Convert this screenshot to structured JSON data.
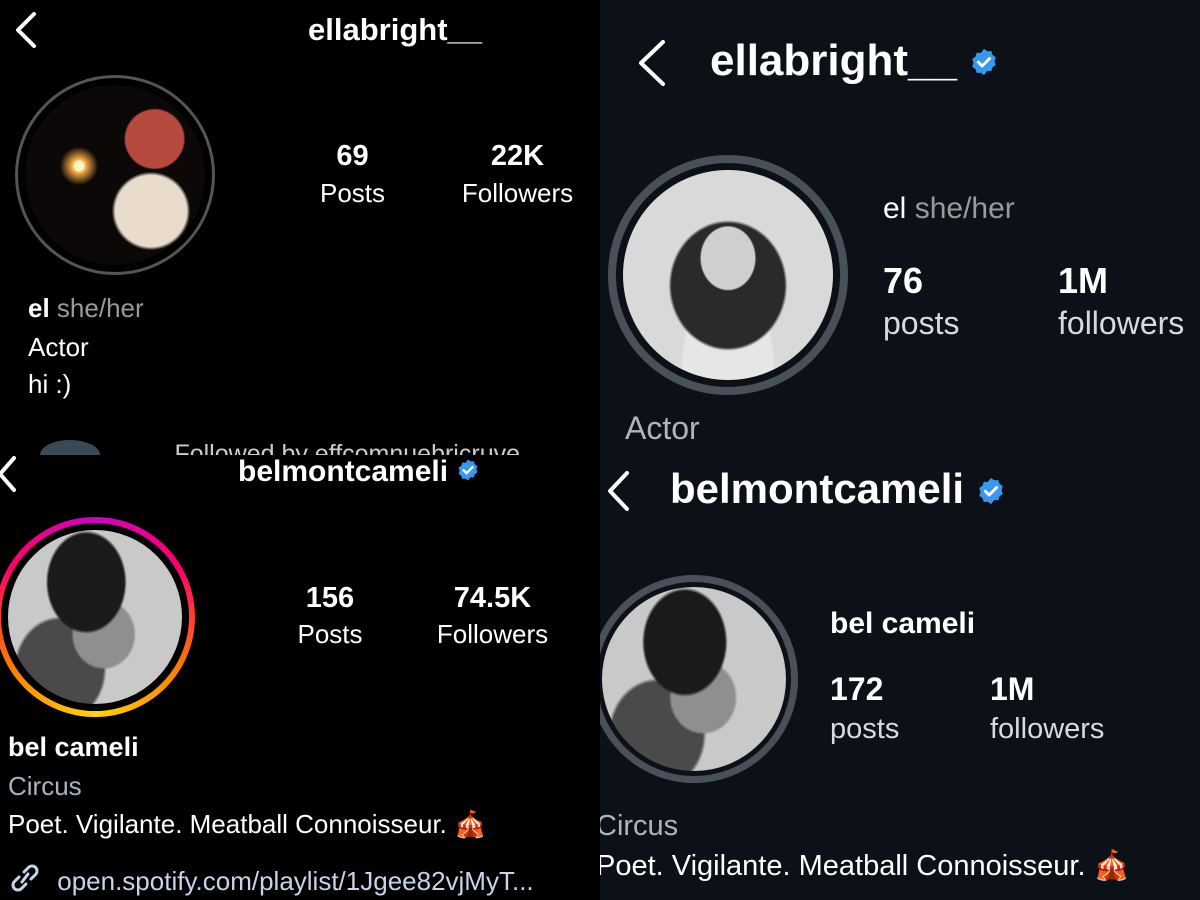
{
  "panels": {
    "top_left": {
      "username": "ellabright__",
      "stats": [
        {
          "value": "69",
          "label": "Posts"
        },
        {
          "value": "22K",
          "label": "Followers"
        }
      ],
      "bio": {
        "name": "el",
        "pronouns": "she/her",
        "category": "Actor",
        "text": "hi :)"
      },
      "followed_by": "Followed by effcomnuebricruve"
    },
    "top_right": {
      "username": "ellabright__",
      "name": "el",
      "pronouns": "she/her",
      "stats": [
        {
          "value": "76",
          "label": "posts"
        },
        {
          "value": "1M",
          "label": "followers"
        }
      ],
      "category": "Actor"
    },
    "bottom_left": {
      "username": "belmontcameli",
      "stats": [
        {
          "value": "156",
          "label": "Posts"
        },
        {
          "value": "74.5K",
          "label": "Followers"
        }
      ],
      "bio": {
        "name": "bel cameli",
        "category": "Circus",
        "text": "Poet. Vigilante. Meatball Connoisseur. 🎪",
        "link": "open.spotify.com/playlist/1Jgee82vjMyT..."
      }
    },
    "bottom_right": {
      "username": "belmontcameli",
      "name": "bel cameli",
      "stats": [
        {
          "value": "172",
          "label": "posts"
        },
        {
          "value": "1M",
          "label": "followers"
        }
      ],
      "category": "Circus",
      "text": "Poet. Vigilante. Meatball Connoisseur. 🎪"
    }
  },
  "colors": {
    "verified_badge": "#3897f0",
    "story_ring_start": "#fd1d1d",
    "story_ring_end": "#fcaf45",
    "dark_bg": "#0c1118"
  },
  "icons": [
    "back-arrow-icon",
    "verified-badge-icon",
    "link-icon",
    "circus-tent-icon"
  ]
}
